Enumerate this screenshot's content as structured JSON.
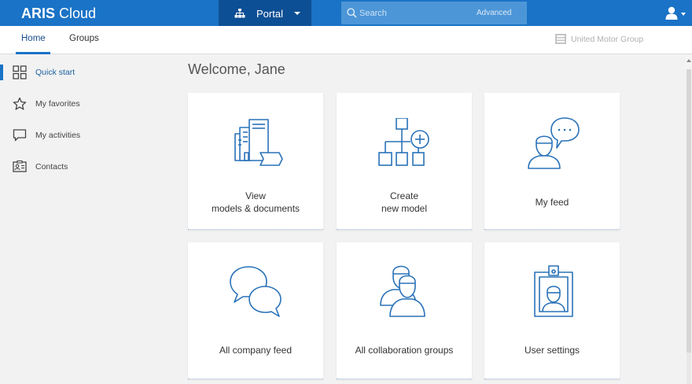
{
  "header": {
    "brand_bold": "ARIS",
    "brand_light": "Cloud",
    "portal_label": "Portal",
    "search_placeholder": "Search",
    "advanced_label": "Advanced",
    "user_icon": "user-icon",
    "accent_color": "#1a73c6"
  },
  "nav": {
    "tabs": [
      {
        "label": "Home",
        "active": true
      },
      {
        "label": "Groups",
        "active": false
      }
    ],
    "organization": "United Motor Group"
  },
  "sidebar": {
    "items": [
      {
        "label": "Quick start",
        "icon": "grid-icon",
        "active": true
      },
      {
        "label": "My favorites",
        "icon": "star-icon",
        "active": false
      },
      {
        "label": "My activities",
        "icon": "speech-bubble-icon",
        "active": false
      },
      {
        "label": "Contacts",
        "icon": "contact-card-icon",
        "active": false
      }
    ]
  },
  "main": {
    "welcome": "Welcome, Jane",
    "tiles": [
      {
        "label": "View\nmodels & documents",
        "icon": "documents-icon"
      },
      {
        "label": "Create\nnew model",
        "icon": "model-diagram-icon"
      },
      {
        "label": "My feed",
        "icon": "feed-user-icon"
      },
      {
        "label": "All company feed",
        "icon": "chat-bubbles-icon"
      },
      {
        "label": "All collaboration groups",
        "icon": "group-users-icon"
      },
      {
        "label": "User settings",
        "icon": "id-badge-icon"
      }
    ]
  }
}
